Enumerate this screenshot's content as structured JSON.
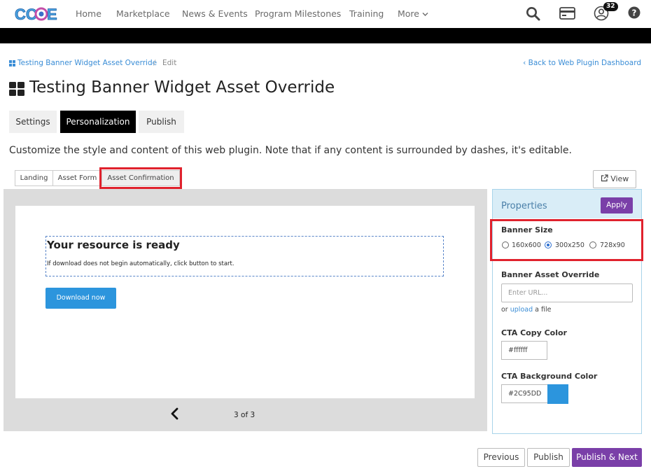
{
  "app": {
    "logo_text": "CCOE"
  },
  "nav": {
    "items": [
      "Home",
      "Marketplace",
      "News & Events",
      "Program Milestones",
      "Training",
      "More"
    ],
    "notification_count": "32"
  },
  "breadcrumb": {
    "parent": "Testing Banner Widget Asset Override",
    "separator": "/",
    "current": "Edit",
    "back_link": "Back to Web Plugin Dashboard"
  },
  "page": {
    "title": "Testing Banner Widget Asset Override",
    "description": "Customize the style and content of this web plugin. Note that if any content is surrounded by dashes, it's editable."
  },
  "main_tabs": [
    {
      "label": "Settings",
      "active": false
    },
    {
      "label": "Personalization",
      "active": true
    },
    {
      "label": "Publish",
      "active": false
    }
  ],
  "sub_tabs": [
    {
      "label": "Landing",
      "active": false
    },
    {
      "label": "Asset Form",
      "active": false
    },
    {
      "label": "Asset Confirmation",
      "active": true
    }
  ],
  "view_button": "View",
  "preview": {
    "heading": "Your resource is ready",
    "subtext": "If download does not begin automatically, click button to start.",
    "button": "Download now",
    "pager": "3 of 3"
  },
  "properties": {
    "title": "Properties",
    "apply": "Apply",
    "banner_size": {
      "label": "Banner Size",
      "options": [
        "160x600",
        "300x250",
        "728x90"
      ],
      "selected": "300x250"
    },
    "asset_override": {
      "label": "Banner Asset Override",
      "placeholder": "Enter URL...",
      "or": "or",
      "upload": "upload",
      "a_file": "a file"
    },
    "cta_copy_color": {
      "label": "CTA Copy Color",
      "value": "#ffffff"
    },
    "cta_bg_color": {
      "label": "CTA Background Color",
      "value": "#2C95DD"
    }
  },
  "footer_buttons": {
    "previous": "Previous",
    "publish": "Publish",
    "publish_next": "Publish & Next"
  },
  "colors": {
    "accent_purple": "#7a3fa8",
    "link_blue": "#3a8dd6",
    "cta_blue": "#2c95dd",
    "highlight_red": "#e0222d"
  }
}
